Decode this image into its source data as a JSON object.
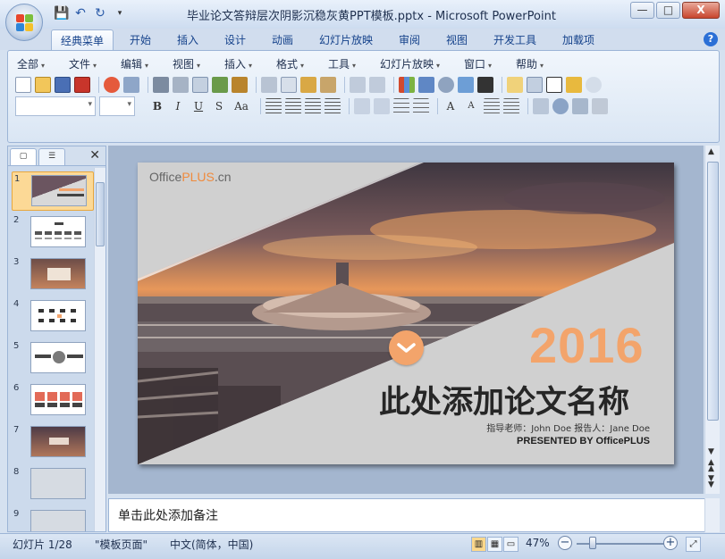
{
  "window": {
    "title": "毕业论文答辩层次阴影沉稳灰黄PPT模板.pptx - Microsoft PowerPoint",
    "controls": [
      "—",
      "□",
      "X"
    ]
  },
  "ribbon_tabs": [
    "经典菜单",
    "开始",
    "插入",
    "设计",
    "动画",
    "幻灯片放映",
    "审阅",
    "视图",
    "开发工具",
    "加载项"
  ],
  "active_tab": "经典菜单",
  "classic_menus": [
    "全部",
    "文件",
    "编辑",
    "视图",
    "插入",
    "格式",
    "工具",
    "幻灯片放映",
    "窗口",
    "帮助"
  ],
  "format_buttons": [
    "B",
    "I",
    "U",
    "S",
    "Aa"
  ],
  "slide_panel": {
    "close": "✕",
    "thumbnails": [
      {
        "num": "1",
        "selected": true
      },
      {
        "num": "2",
        "selected": false
      },
      {
        "num": "3",
        "selected": false
      },
      {
        "num": "4",
        "selected": false
      },
      {
        "num": "5",
        "selected": false
      },
      {
        "num": "6",
        "selected": false
      },
      {
        "num": "7",
        "selected": false
      },
      {
        "num": "8",
        "selected": false
      },
      {
        "num": "9",
        "selected": false
      }
    ]
  },
  "slide": {
    "logo_prefix": "Office",
    "logo_brand": "PLUS",
    "logo_suffix": ".cn",
    "year": "2016",
    "title": "此处添加论文名称",
    "advisor": "指导老师：John Doe 报告人：Jane Doe",
    "presented": "PRESENTED BY OfficePLUS",
    "accent_color": "#f3a46b"
  },
  "notes_placeholder": "单击此处添加备注",
  "status": {
    "slide_counter": "幻灯片 1/28",
    "theme": "\"模板页面\"",
    "language": "中文(简体，中国)",
    "zoom": "47%",
    "zoom_fraction": 0.47
  }
}
